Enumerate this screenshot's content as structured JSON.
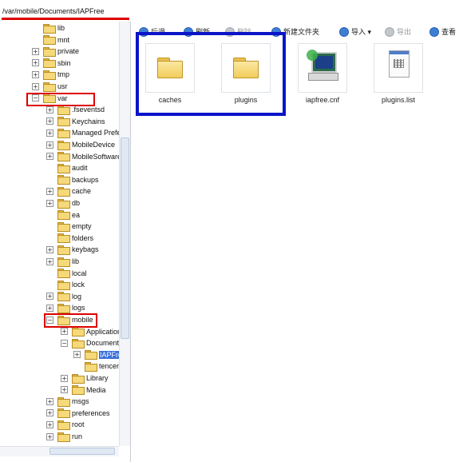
{
  "address": {
    "path": "/var/mobile/Documents/IAPFree"
  },
  "toolbar": {
    "back": "后退",
    "refresh": "刷新",
    "delete": "删除",
    "new_folder": "新建文件夹",
    "import": "导入 ▾",
    "export": "导出",
    "view": "查看"
  },
  "tree": {
    "items": [
      {
        "label": "lib",
        "expander": "",
        "icon": "folder-icon"
      },
      {
        "label": "mnt",
        "expander": "",
        "icon": "folder-icon"
      },
      {
        "label": "private",
        "expander": "+",
        "icon": "folder-icon"
      },
      {
        "label": "sbin",
        "expander": "+",
        "icon": "folder-icon"
      },
      {
        "label": "tmp",
        "expander": "+",
        "icon": "folder-link-icon"
      },
      {
        "label": "usr",
        "expander": "+",
        "icon": "folder-icon"
      },
      {
        "label": "var",
        "expander": "−",
        "icon": "folder-link-icon"
      },
      {
        "label": ".fseventsd",
        "expander": "+",
        "icon": "folder-icon"
      },
      {
        "label": "Keychains",
        "expander": "+",
        "icon": "folder-icon"
      },
      {
        "label": "Managed Prefe",
        "expander": "+",
        "icon": "folder-icon"
      },
      {
        "label": "MobileDevice",
        "expander": "+",
        "icon": "folder-icon"
      },
      {
        "label": "MobileSoftware",
        "expander": "+",
        "icon": "folder-icon"
      },
      {
        "label": "audit",
        "expander": "",
        "icon": "folder-icon"
      },
      {
        "label": "backups",
        "expander": "",
        "icon": "folder-icon"
      },
      {
        "label": "cache",
        "expander": "+",
        "icon": "folder-icon"
      },
      {
        "label": "db",
        "expander": "+",
        "icon": "folder-icon"
      },
      {
        "label": "ea",
        "expander": "",
        "icon": "folder-icon"
      },
      {
        "label": "empty",
        "expander": "",
        "icon": "folder-icon"
      },
      {
        "label": "folders",
        "expander": "",
        "icon": "folder-icon"
      },
      {
        "label": "keybags",
        "expander": "+",
        "icon": "folder-icon"
      },
      {
        "label": "lib",
        "expander": "+",
        "icon": "folder-icon"
      },
      {
        "label": "local",
        "expander": "",
        "icon": "folder-icon"
      },
      {
        "label": "lock",
        "expander": "",
        "icon": "folder-icon"
      },
      {
        "label": "log",
        "expander": "+",
        "icon": "folder-icon"
      },
      {
        "label": "logs",
        "expander": "+",
        "icon": "folder-icon"
      },
      {
        "label": "mobile",
        "expander": "−",
        "icon": "folder-icon"
      },
      {
        "label": "Application",
        "expander": "+",
        "icon": "folder-icon"
      },
      {
        "label": "Documents",
        "expander": "−",
        "icon": "folder-icon"
      },
      {
        "label": "IAPFre",
        "expander": "+",
        "icon": "folder-icon"
      },
      {
        "label": "tencer",
        "expander": "",
        "icon": "folder-icon"
      },
      {
        "label": "Library",
        "expander": "+",
        "icon": "folder-icon"
      },
      {
        "label": "Media",
        "expander": "+",
        "icon": "folder-icon"
      },
      {
        "label": "msgs",
        "expander": "+",
        "icon": "folder-icon"
      },
      {
        "label": "preferences",
        "expander": "+",
        "icon": "folder-icon"
      },
      {
        "label": "root",
        "expander": "+",
        "icon": "folder-icon"
      },
      {
        "label": "run",
        "expander": "+",
        "icon": "folder-icon"
      }
    ]
  },
  "files": [
    {
      "name": "caches",
      "icon": "folder-icon"
    },
    {
      "name": "plugins",
      "icon": "folder-icon"
    },
    {
      "name": "iapfree.cnf",
      "icon": "config-file-icon"
    },
    {
      "name": "plugins.list",
      "icon": "list-file-icon"
    }
  ],
  "colors": {
    "highlight_red": "#dd0000",
    "highlight_blue": "#0a14c8",
    "selection": "#3a6fd8"
  }
}
